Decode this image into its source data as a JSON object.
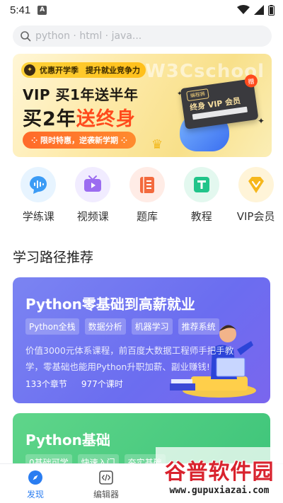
{
  "status_bar": {
    "time": "5:41",
    "notification_letter": "A"
  },
  "search": {
    "placeholder": "python · html · java..."
  },
  "banner": {
    "tag_brand": "优惠开学季",
    "tag_slogan": "提升就业竞争力",
    "line1": "VIP 买1年送半年",
    "line2_prefix": "买2年",
    "line2_highlight": "送终身",
    "cta": "⁘ 限时特惠，逆袭新学期 ⁘",
    "watermark": "W3Cschool",
    "card_brand": "编程狮",
    "card_label": "终身 VIP 会员",
    "card_badge": "赠"
  },
  "categories": [
    {
      "label": "学练课",
      "icon": "audio-wave-icon",
      "bg": "#e7f4ff",
      "fg": "#3b9bf5"
    },
    {
      "label": "视频课",
      "icon": "tv-icon",
      "bg": "#f1ecff",
      "fg": "#9b6cf0"
    },
    {
      "label": "题库",
      "icon": "question-bank-icon",
      "bg": "#ffece6",
      "fg": "#f36a3e"
    },
    {
      "label": "教程",
      "icon": "tutorial-icon",
      "bg": "#e3f8ef",
      "fg": "#21c48a"
    },
    {
      "label": "VIP会员",
      "icon": "vip-diamond-icon",
      "bg": "#fff4d8",
      "fg": "#f6b71c"
    }
  ],
  "section_title": "学习路径推荐",
  "cards": [
    {
      "title": "Python零基础到高薪就业",
      "chips": [
        "Python全栈",
        "数据分析",
        "机器学习",
        "推荐系统"
      ],
      "desc": "价值3000元体系课程，前百度大数据工程师手把手教学，零基础也能用Python升职加薪、副业赚钱!",
      "chapters": "133个章节",
      "lessons": "977个课时"
    },
    {
      "title": "Python基础",
      "chips": [
        "0基础可学",
        "快速入门",
        "夯实基础"
      ]
    }
  ],
  "bottom_nav": [
    {
      "label": "发现",
      "icon": "compass-icon",
      "active": true
    },
    {
      "label": "编辑器",
      "icon": "code-editor-icon",
      "active": false
    }
  ],
  "site_watermark": {
    "title": "谷普软件园",
    "url": "www.gupuxiazai.com"
  },
  "colors": {
    "accent": "#2a7df1",
    "card1": "#7378f0",
    "card2": "#4fcd82",
    "banner_red": "#ff4a1c"
  }
}
